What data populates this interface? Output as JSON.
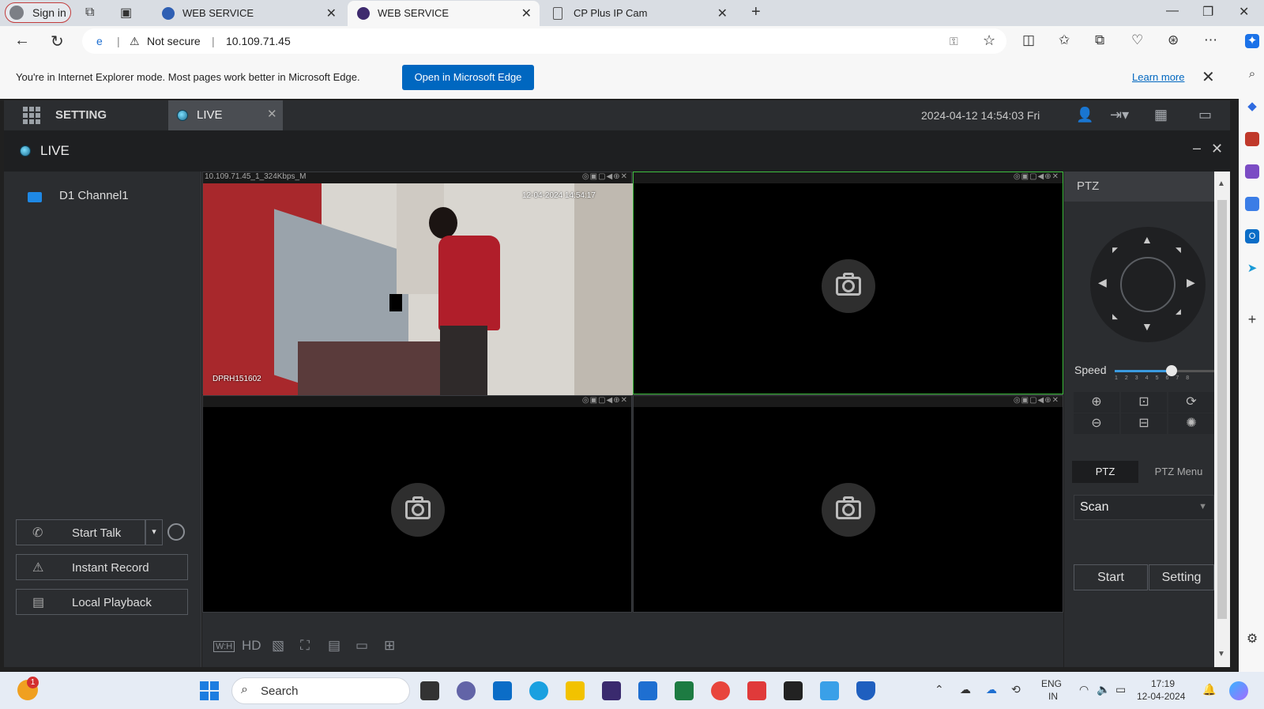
{
  "browser": {
    "signin_label": "Sign in",
    "tabs": [
      {
        "label": "WEB SERVICE",
        "active": false
      },
      {
        "label": "WEB SERVICE",
        "active": true
      },
      {
        "label": "CP Plus IP Cam",
        "active": false
      }
    ],
    "security_label": "Not secure",
    "url": "10.109.71.45"
  },
  "ie_banner": {
    "message": "You're in Internet Explorer mode. Most pages work better in Microsoft Edge.",
    "open_button": "Open in Microsoft Edge",
    "learn_more": "Learn more"
  },
  "app": {
    "setting_label": "SETTING",
    "live_tab": "LIVE",
    "datetime": "2024-04-12 14:54:03 Fri",
    "live_title": "LIVE",
    "channel": "D1 Channel1",
    "buttons": {
      "start_talk": "Start Talk",
      "instant_record": "Instant Record",
      "local_playback": "Local Playback"
    },
    "video": {
      "cell1_header": "10.109.71.45_1_324Kbps_M",
      "cell1_osd_time": "12-04-2024 14:54:17",
      "cell1_osd_model": "DPRH151602",
      "toolbar_hd": "HD",
      "toolbar_wh": "W:H"
    },
    "ptz": {
      "title": "PTZ",
      "speed_label": "Speed",
      "speed_value": 5,
      "speed_max": 8,
      "speed_ticks": "12345678",
      "tab_ptz": "PTZ",
      "tab_menu": "PTZ Menu",
      "scan_value": "Scan",
      "start_label": "Start",
      "setting_label": "Setting"
    }
  },
  "taskbar": {
    "search_placeholder": "Search",
    "notification_count": "1",
    "lang_top": "ENG",
    "lang_bottom": "IN",
    "time": "17:19",
    "date": "12-04-2024"
  },
  "colors": {
    "edge_blue": "#0067c0",
    "app_dark": "#2b2d30",
    "active_cell_border": "#3fbf3f"
  }
}
